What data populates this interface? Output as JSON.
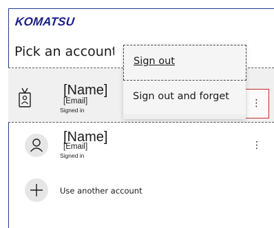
{
  "brand": {
    "logo_text": "KOMATSU",
    "logo_color": "#1d2088"
  },
  "header": {
    "title": "Pick an account"
  },
  "accounts": [
    {
      "name": "[Name]",
      "email": "[Email]",
      "status": "Signed in",
      "icon": "badge-icon",
      "selected": true,
      "more_label": "⋮"
    },
    {
      "name": "[Name]",
      "email": "[Email]",
      "status": "Signed in",
      "icon": "person-icon",
      "selected": false,
      "more_label": "⋮"
    }
  ],
  "add_account": {
    "label": "Use another account",
    "icon": "plus-icon"
  },
  "context_menu": {
    "items": [
      {
        "label": "Sign out"
      },
      {
        "label": "Sign out and forget"
      }
    ]
  },
  "colors": {
    "highlight_border": "#c42b2b",
    "selected_row_bg": "#f0f0f0"
  }
}
